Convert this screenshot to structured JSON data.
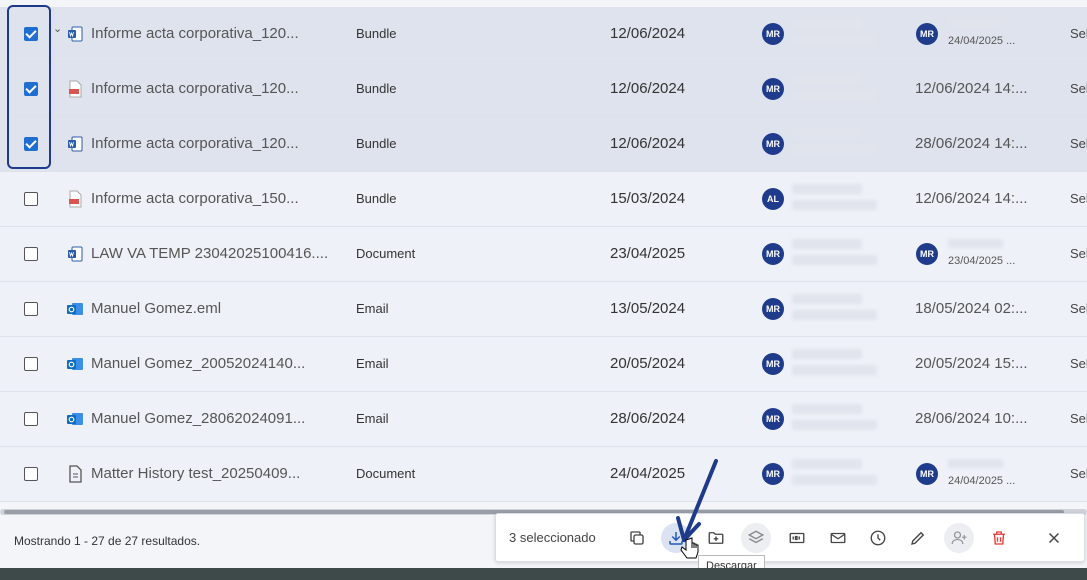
{
  "rows": [
    {
      "name": "Informe acta corporativa_120...",
      "type": "Bundle",
      "date": "12/06/2024",
      "owner": "MR",
      "modifier": "MR",
      "modified": "",
      "modified_sub": "24/04/2025 ...",
      "col": "Sel",
      "checked": true,
      "icon": "word-icon"
    },
    {
      "name": "Informe acta corporativa_120...",
      "type": "Bundle",
      "date": "12/06/2024",
      "owner": "MR",
      "modifier": "",
      "modified": "12/06/2024 14:...",
      "modified_sub": "",
      "col": "Sel",
      "checked": true,
      "icon": "pdf-icon"
    },
    {
      "name": "Informe acta corporativa_120...",
      "type": "Bundle",
      "date": "12/06/2024",
      "owner": "MR",
      "modifier": "",
      "modified": "28/06/2024 14:...",
      "modified_sub": "",
      "col": "Sel",
      "checked": true,
      "icon": "word-icon"
    },
    {
      "name": "Informe acta corporativa_150...",
      "type": "Bundle",
      "date": "15/03/2024",
      "owner": "AL",
      "modifier": "",
      "modified": "12/06/2024 14:...",
      "modified_sub": "",
      "col": "Sel",
      "checked": false,
      "icon": "pdf-icon"
    },
    {
      "name": "LAW VA TEMP 23042025100416....",
      "type": "Document",
      "date": "23/04/2025",
      "owner": "MR",
      "modifier": "MR",
      "modified": "",
      "modified_sub": "23/04/2025 ...",
      "col": "Sel",
      "checked": false,
      "icon": "word-icon"
    },
    {
      "name": "Manuel Gomez.eml",
      "type": "Email",
      "date": "13/05/2024",
      "owner": "MR",
      "modifier": "",
      "modified": "18/05/2024 02:...",
      "modified_sub": "",
      "col": "Sel",
      "checked": false,
      "icon": "outlook-icon"
    },
    {
      "name": "Manuel Gomez_20052024140...",
      "type": "Email",
      "date": "20/05/2024",
      "owner": "MR",
      "modifier": "",
      "modified": "20/05/2024 15:...",
      "modified_sub": "",
      "col": "Sel",
      "checked": false,
      "icon": "outlook-icon"
    },
    {
      "name": "Manuel Gomez_28062024091...",
      "type": "Email",
      "date": "28/06/2024",
      "owner": "MR",
      "modifier": "",
      "modified": "28/06/2024 10:...",
      "modified_sub": "",
      "col": "Sel",
      "checked": false,
      "icon": "outlook-icon"
    },
    {
      "name": "Matter History test_20250409...",
      "type": "Document",
      "date": "24/04/2025",
      "owner": "MR",
      "modifier": "MR",
      "modified": "",
      "modified_sub": "24/04/2025 ...",
      "col": "Sel",
      "checked": false,
      "icon": "document-icon"
    }
  ],
  "footer": {
    "showing": "Mostrando 1 - 27 de 27 resultados."
  },
  "actionbar": {
    "selected_count": "3 seleccionado",
    "tooltip": "Descargar"
  },
  "colors": {
    "accent": "#1f6fd1",
    "avatar": "#1f3b8c",
    "delete": "#e53935",
    "highlight": "#1e3a8a"
  }
}
